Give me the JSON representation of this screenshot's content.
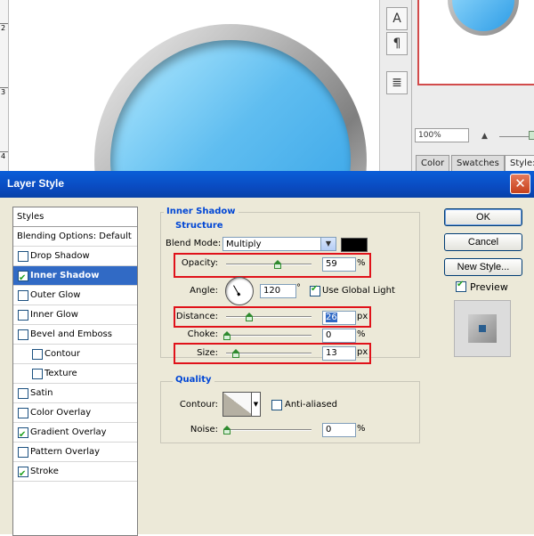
{
  "ruler": {
    "labels": [
      "2",
      "3",
      "4"
    ]
  },
  "toolbar_glyphs": [
    "A",
    "¶",
    "≣"
  ],
  "right_panel": {
    "zoom": "100%",
    "tabs": [
      "Color",
      "Swatches",
      "Style:"
    ]
  },
  "dialog": {
    "title": "Layer Style",
    "close_glyph": "✕",
    "styles_header": "Styles",
    "items": [
      {
        "label": "Blending Options: Default",
        "checkbox": false,
        "checked": false,
        "selected": false
      },
      {
        "label": "Drop Shadow",
        "checkbox": true,
        "checked": false,
        "selected": false
      },
      {
        "label": "Inner Shadow",
        "checkbox": true,
        "checked": true,
        "selected": true
      },
      {
        "label": "Outer Glow",
        "checkbox": true,
        "checked": false,
        "selected": false
      },
      {
        "label": "Inner Glow",
        "checkbox": true,
        "checked": false,
        "selected": false
      },
      {
        "label": "Bevel and Emboss",
        "checkbox": true,
        "checked": false,
        "selected": false
      },
      {
        "label": "Contour",
        "checkbox": true,
        "checked": false,
        "selected": false,
        "indent": true
      },
      {
        "label": "Texture",
        "checkbox": true,
        "checked": false,
        "selected": false,
        "indent": true
      },
      {
        "label": "Satin",
        "checkbox": true,
        "checked": false,
        "selected": false
      },
      {
        "label": "Color Overlay",
        "checkbox": true,
        "checked": false,
        "selected": false
      },
      {
        "label": "Gradient Overlay",
        "checkbox": true,
        "checked": true,
        "selected": false
      },
      {
        "label": "Pattern Overlay",
        "checkbox": true,
        "checked": false,
        "selected": false
      },
      {
        "label": "Stroke",
        "checkbox": true,
        "checked": true,
        "selected": false
      }
    ],
    "inner_shadow": {
      "title": "Inner Shadow",
      "structure_title": "Structure",
      "blend_mode_label": "Blend Mode:",
      "blend_mode_value": "Multiply",
      "shadow_color": "#000000",
      "opacity_label": "Opacity:",
      "opacity_value": "59",
      "opacity_unit": "%",
      "angle_label": "Angle:",
      "angle_value": "120",
      "angle_unit": "°",
      "global_light_label": "Use Global Light",
      "global_light_checked": true,
      "distance_label": "Distance:",
      "distance_value": "26",
      "distance_unit": "px",
      "choke_label": "Choke:",
      "choke_value": "0",
      "choke_unit": "%",
      "size_label": "Size:",
      "size_value": "13",
      "size_unit": "px"
    },
    "quality": {
      "title": "Quality",
      "contour_label": "Contour:",
      "anti_aliased_label": "Anti-aliased",
      "anti_aliased_checked": false,
      "noise_label": "Noise:",
      "noise_value": "0",
      "noise_unit": "%"
    },
    "buttons": {
      "ok": "OK",
      "cancel": "Cancel",
      "new_style": "New Style...",
      "preview_label": "Preview",
      "preview_checked": true
    },
    "highlight_color": "#e0121a"
  }
}
